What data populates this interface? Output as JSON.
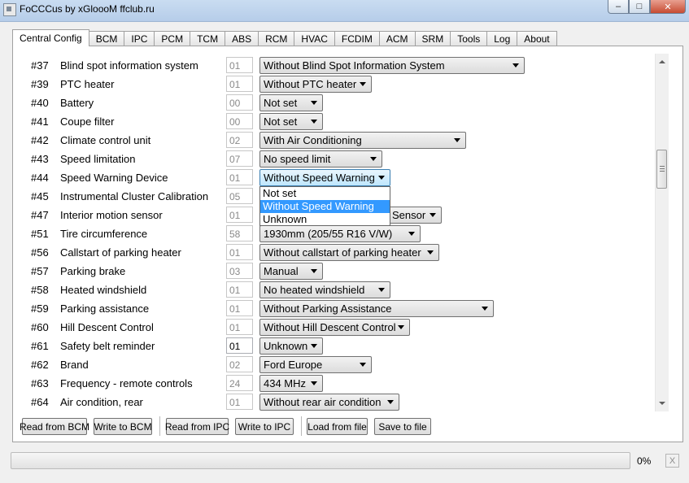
{
  "window": {
    "title": "FoCCCus by xGloooM ffclub.ru",
    "buttons": [
      "minimize",
      "maximize",
      "close"
    ]
  },
  "tabs": [
    "Central Config",
    "BCM",
    "IPC",
    "PCM",
    "TCM",
    "ABS",
    "RCM",
    "HVAC",
    "FCDIM",
    "ACM",
    "SRM",
    "Tools",
    "Log",
    "About"
  ],
  "active_tab": "Central Config",
  "rows": [
    {
      "num": "#37",
      "label": "Blind spot information system",
      "code": "01",
      "value": "Without Blind Spot Information System"
    },
    {
      "num": "#39",
      "label": "PTC heater",
      "code": "01",
      "value": "Without PTC heater"
    },
    {
      "num": "#40",
      "label": "Battery",
      "code": "00",
      "value": "Not set"
    },
    {
      "num": "#41",
      "label": "Coupe filter",
      "code": "00",
      "value": "Not set"
    },
    {
      "num": "#42",
      "label": "Climate control unit",
      "code": "02",
      "value": "With Air Conditioning"
    },
    {
      "num": "#43",
      "label": "Speed limitation",
      "code": "07",
      "value": "No speed limit"
    },
    {
      "num": "#44",
      "label": "Speed Warning Device",
      "code": "01",
      "value": "Without Speed Warning"
    },
    {
      "num": "#45",
      "label": "Instrumental Cluster Calibration",
      "code": "05",
      "value": ""
    },
    {
      "num": "#47",
      "label": "Interior motion sensor",
      "code": "01",
      "value": "Sensor"
    },
    {
      "num": "#51",
      "label": "Tire circumference",
      "code": "58",
      "value": "1930mm (205/55 R16 V/W)"
    },
    {
      "num": "#56",
      "label": "Callstart of parking heater",
      "code": "01",
      "value": "Without callstart of parking heater"
    },
    {
      "num": "#57",
      "label": "Parking brake",
      "code": "03",
      "value": "Manual"
    },
    {
      "num": "#58",
      "label": "Heated windshield",
      "code": "01",
      "value": "No heated windshield"
    },
    {
      "num": "#59",
      "label": "Parking assistance",
      "code": "01",
      "value": "Without Parking Assistance"
    },
    {
      "num": "#60",
      "label": "Hill Descent Control",
      "code": "01",
      "value": "Without Hill Descent Control"
    },
    {
      "num": "#61",
      "label": "Safety belt reminder",
      "code": "01",
      "value": "Unknown"
    },
    {
      "num": "#62",
      "label": "Brand",
      "code": "02",
      "value": "Ford Europe"
    },
    {
      "num": "#63",
      "label": "Frequency - remote controls",
      "code": "24",
      "value": "434 MHz"
    },
    {
      "num": "#64",
      "label": "Air condition, rear",
      "code": "01",
      "value": "Without rear air condition"
    }
  ],
  "dropdown": {
    "options": [
      "Not set",
      "Without Speed Warning",
      "Unknown"
    ],
    "selected": "Without Speed Warning"
  },
  "buttons": {
    "read_bcm": "Read from BCM",
    "write_bcm": "Write to BCM",
    "read_ipc": "Read from IPC",
    "write_ipc": "Write to IPC",
    "load_file": "Load from file",
    "save_file": "Save to file"
  },
  "progress": {
    "value": 0,
    "label": "0%"
  },
  "cancel_label": "X"
}
